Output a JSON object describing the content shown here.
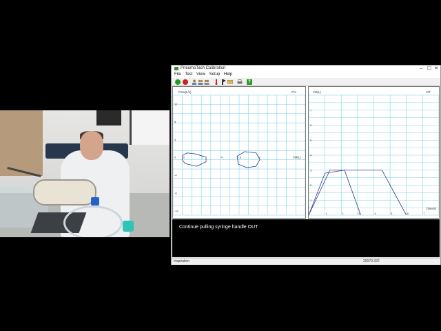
{
  "window": {
    "title": "PneumoTach Calibration",
    "controls": {
      "minimize": "–",
      "maximize": "☐",
      "close": "✕"
    }
  },
  "menu": [
    "File",
    "Test",
    "View",
    "Setup",
    "Help"
  ],
  "toolbar": [
    {
      "icon": "green-circle-icon",
      "color": "#1e9e28"
    },
    {
      "icon": "red-circle-icon",
      "color": "#d21e1e"
    },
    {
      "icon": "person-icon"
    },
    {
      "icon": "group-icon"
    },
    {
      "icon": "group-alt-icon"
    },
    {
      "icon": "thermometer-icon",
      "color": "#cc2020"
    },
    {
      "icon": "thermometer-flag-icon"
    },
    {
      "icon": "email-icon"
    },
    {
      "icon": "printer-icon"
    },
    {
      "icon": "help-icon",
      "glyph": "?",
      "color": "#2f9a2f"
    }
  ],
  "chart_data": [
    {
      "type": "line",
      "xlabel": "Vol(L)",
      "ylabel": "Flow(L/s)",
      "corner_label": "F/V",
      "y_ticks": [
        "12",
        "8",
        "4",
        "0",
        "-4",
        "-8",
        "-12"
      ],
      "x_ticks": [
        "0",
        "2",
        "4",
        "6",
        "8"
      ],
      "series": [
        {
          "points": [
            [
              0,
              0.4
            ],
            [
              0.5,
              1.0
            ],
            [
              1.3,
              0.8
            ],
            [
              2.5,
              0.1
            ],
            [
              2.5,
              -1.0
            ],
            [
              1.5,
              -2.0
            ],
            [
              0.3,
              -1.4
            ],
            [
              0,
              -0.6
            ],
            [
              0,
              0.4
            ]
          ]
        },
        {
          "points": [
            [
              5.8,
              0.3
            ],
            [
              6.6,
              1.3
            ],
            [
              7.8,
              1.0
            ],
            [
              8.2,
              -0.5
            ],
            [
              7.8,
              -2.0
            ],
            [
              6.8,
              -2.3
            ],
            [
              5.9,
              -1.5
            ],
            [
              5.8,
              0.3
            ]
          ]
        }
      ],
      "grid": true
    },
    {
      "type": "line",
      "xlabel": "Time(s)",
      "ylabel": "Vol(L)",
      "corner_label": "V/T",
      "y_ticks": [
        "7",
        "6",
        "5",
        "4",
        "3",
        "2",
        "1"
      ],
      "x_ticks": [
        "1",
        "2",
        "3",
        "4",
        "5",
        "6",
        "7"
      ],
      "series": [
        {
          "points": [
            [
              0,
              0
            ],
            [
              1,
              2.8
            ],
            [
              2.2,
              3.0
            ],
            [
              3.2,
              0
            ]
          ]
        },
        {
          "points": [
            [
              0,
              0
            ],
            [
              1.3,
              3.0
            ],
            [
              4.5,
              3.0
            ],
            [
              6,
              0
            ]
          ]
        }
      ],
      "grid": true
    }
  ],
  "message": "Continue pulling syringe handle OUT",
  "status": {
    "left": "Inspiration",
    "right": "20079.322"
  },
  "colors": {
    "grid": "#7fd3ea",
    "trace": "#2b3a8c",
    "message_bg": "#000000"
  }
}
